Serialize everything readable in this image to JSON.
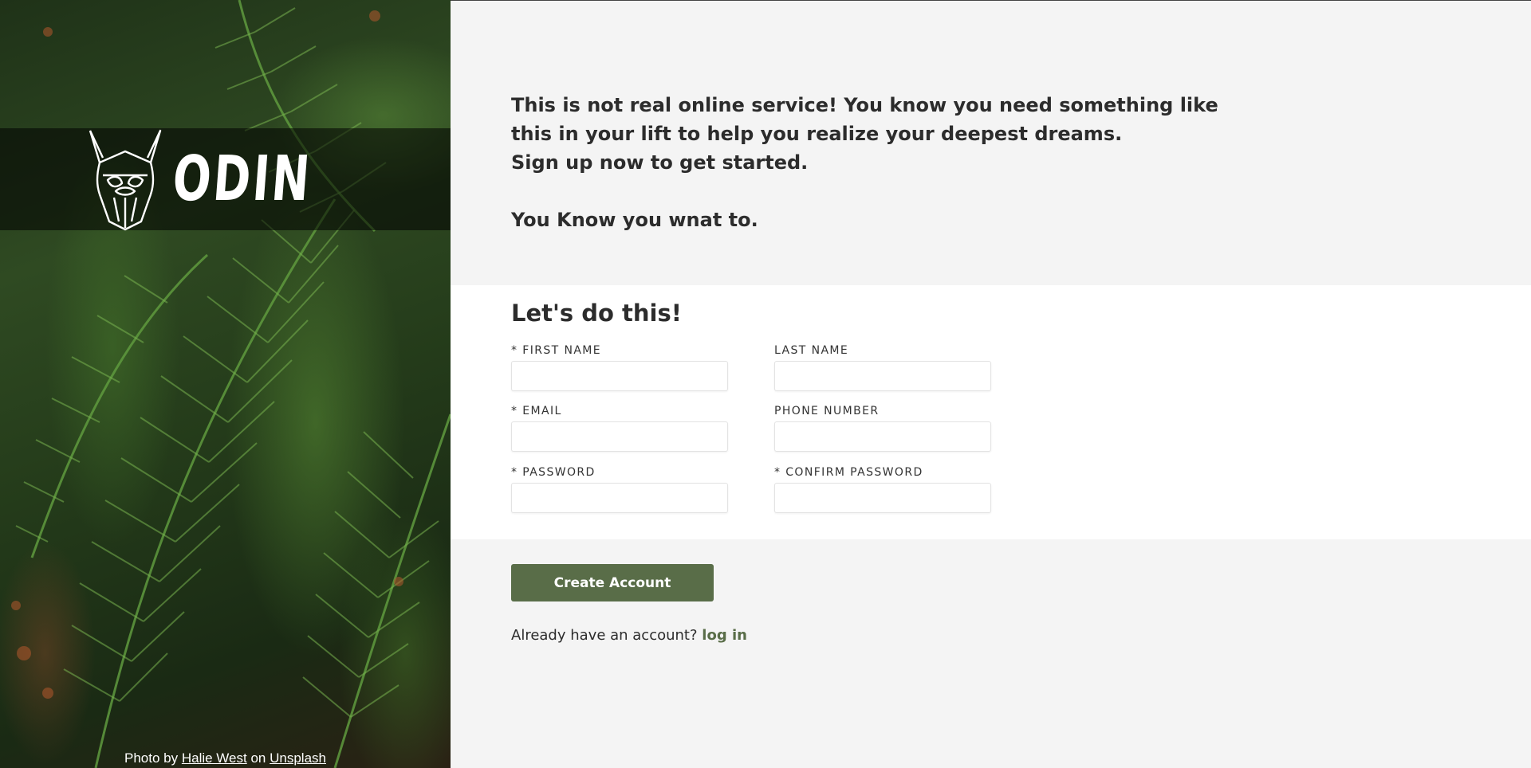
{
  "brand": {
    "logo_text": "ODIN"
  },
  "photo_credit": {
    "prefix": "Photo by",
    "author": "Halie West",
    "middle": "on",
    "site": "Unsplash"
  },
  "intro": {
    "line1": "This is not real online service! You know you need something like",
    "line2": "this in your lift to help you realize your deepest dreams.",
    "line3": "Sign up now to get started.",
    "line4": "You Know you wnat to."
  },
  "form": {
    "title": "Let's do this!",
    "fields": {
      "first_name": {
        "label": "* FIRST NAME",
        "value": "",
        "placeholder": ""
      },
      "last_name": {
        "label": "LAST NAME",
        "value": "",
        "placeholder": ""
      },
      "email": {
        "label": "* EMAIL",
        "value": "",
        "placeholder": ""
      },
      "phone": {
        "label": "PHONE NUMBER",
        "value": "",
        "placeholder": ""
      },
      "password": {
        "label": "* PASSWORD",
        "value": "",
        "placeholder": ""
      },
      "confirm_password": {
        "label": "* CONFIRM PASSWORD",
        "value": "",
        "placeholder": ""
      }
    }
  },
  "actions": {
    "create_account_label": "Create Account",
    "login_prompt": "Already have an account?",
    "login_link": "log in"
  },
  "colors": {
    "accent": "#596d48",
    "page_background": "#f4f4f4",
    "form_background": "#ffffff",
    "text": "#2c2c2c"
  }
}
